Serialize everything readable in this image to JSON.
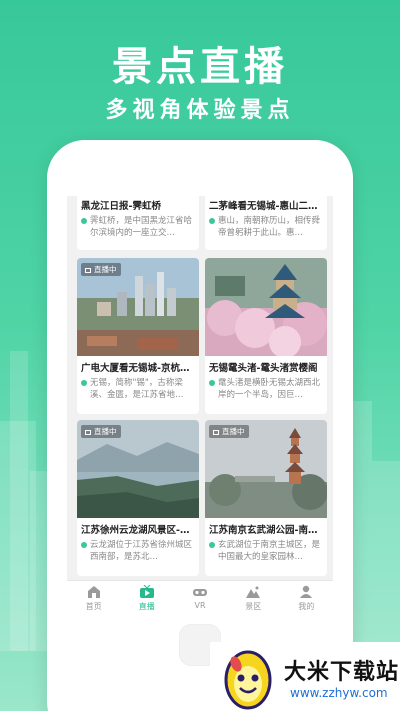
{
  "hero": {
    "title": "景点直播",
    "subtitle": "多视角体验景点"
  },
  "cards": [
    {
      "title": "黑龙江日报-霁虹桥",
      "desc": "霁虹桥，是中国黑龙江省哈尔滨境内的一座立交…",
      "live": ""
    },
    {
      "title": "二茅峰看无锡城-惠山二…",
      "desc": "惠山，南朝称历山，相传舜帝曾躬耕于此山。惠…",
      "live": ""
    },
    {
      "title": "广电大厦看无锡城-京杭…",
      "desc": "无锡，简称\"锡\"，古称梁溪、金匮，是江苏省地…",
      "live": "直播中"
    },
    {
      "title": "无锡鼋头渚-鼋头渚赏樱阁",
      "desc": "鼋头渚是横卧无锡太湖西北岸的一个半岛，因巨…",
      "live": "直播中"
    },
    {
      "title": "江苏徐州云龙湖风景区-…",
      "desc": "云龙湖位于江苏省徐州城区西南部，是苏北…",
      "live": "直播中"
    },
    {
      "title": "江苏南京玄武湖公园-南…",
      "desc": "玄武湖位于南京主城区，是中国最大的皇家园林…",
      "live": "直播中"
    }
  ],
  "tabs": [
    {
      "label": "首页",
      "icon": "home-icon"
    },
    {
      "label": "直播",
      "icon": "live-tv-icon",
      "active": true
    },
    {
      "label": "VR",
      "icon": "vr-headset-icon"
    },
    {
      "label": "景区",
      "icon": "mountain-icon"
    },
    {
      "label": "我的",
      "icon": "user-icon"
    }
  ],
  "watermark": {
    "name": "大米下载站",
    "url": "www.zzhyw.com"
  },
  "colors": {
    "brand_green": "#37c89a",
    "tab_active": "#25b98d"
  }
}
